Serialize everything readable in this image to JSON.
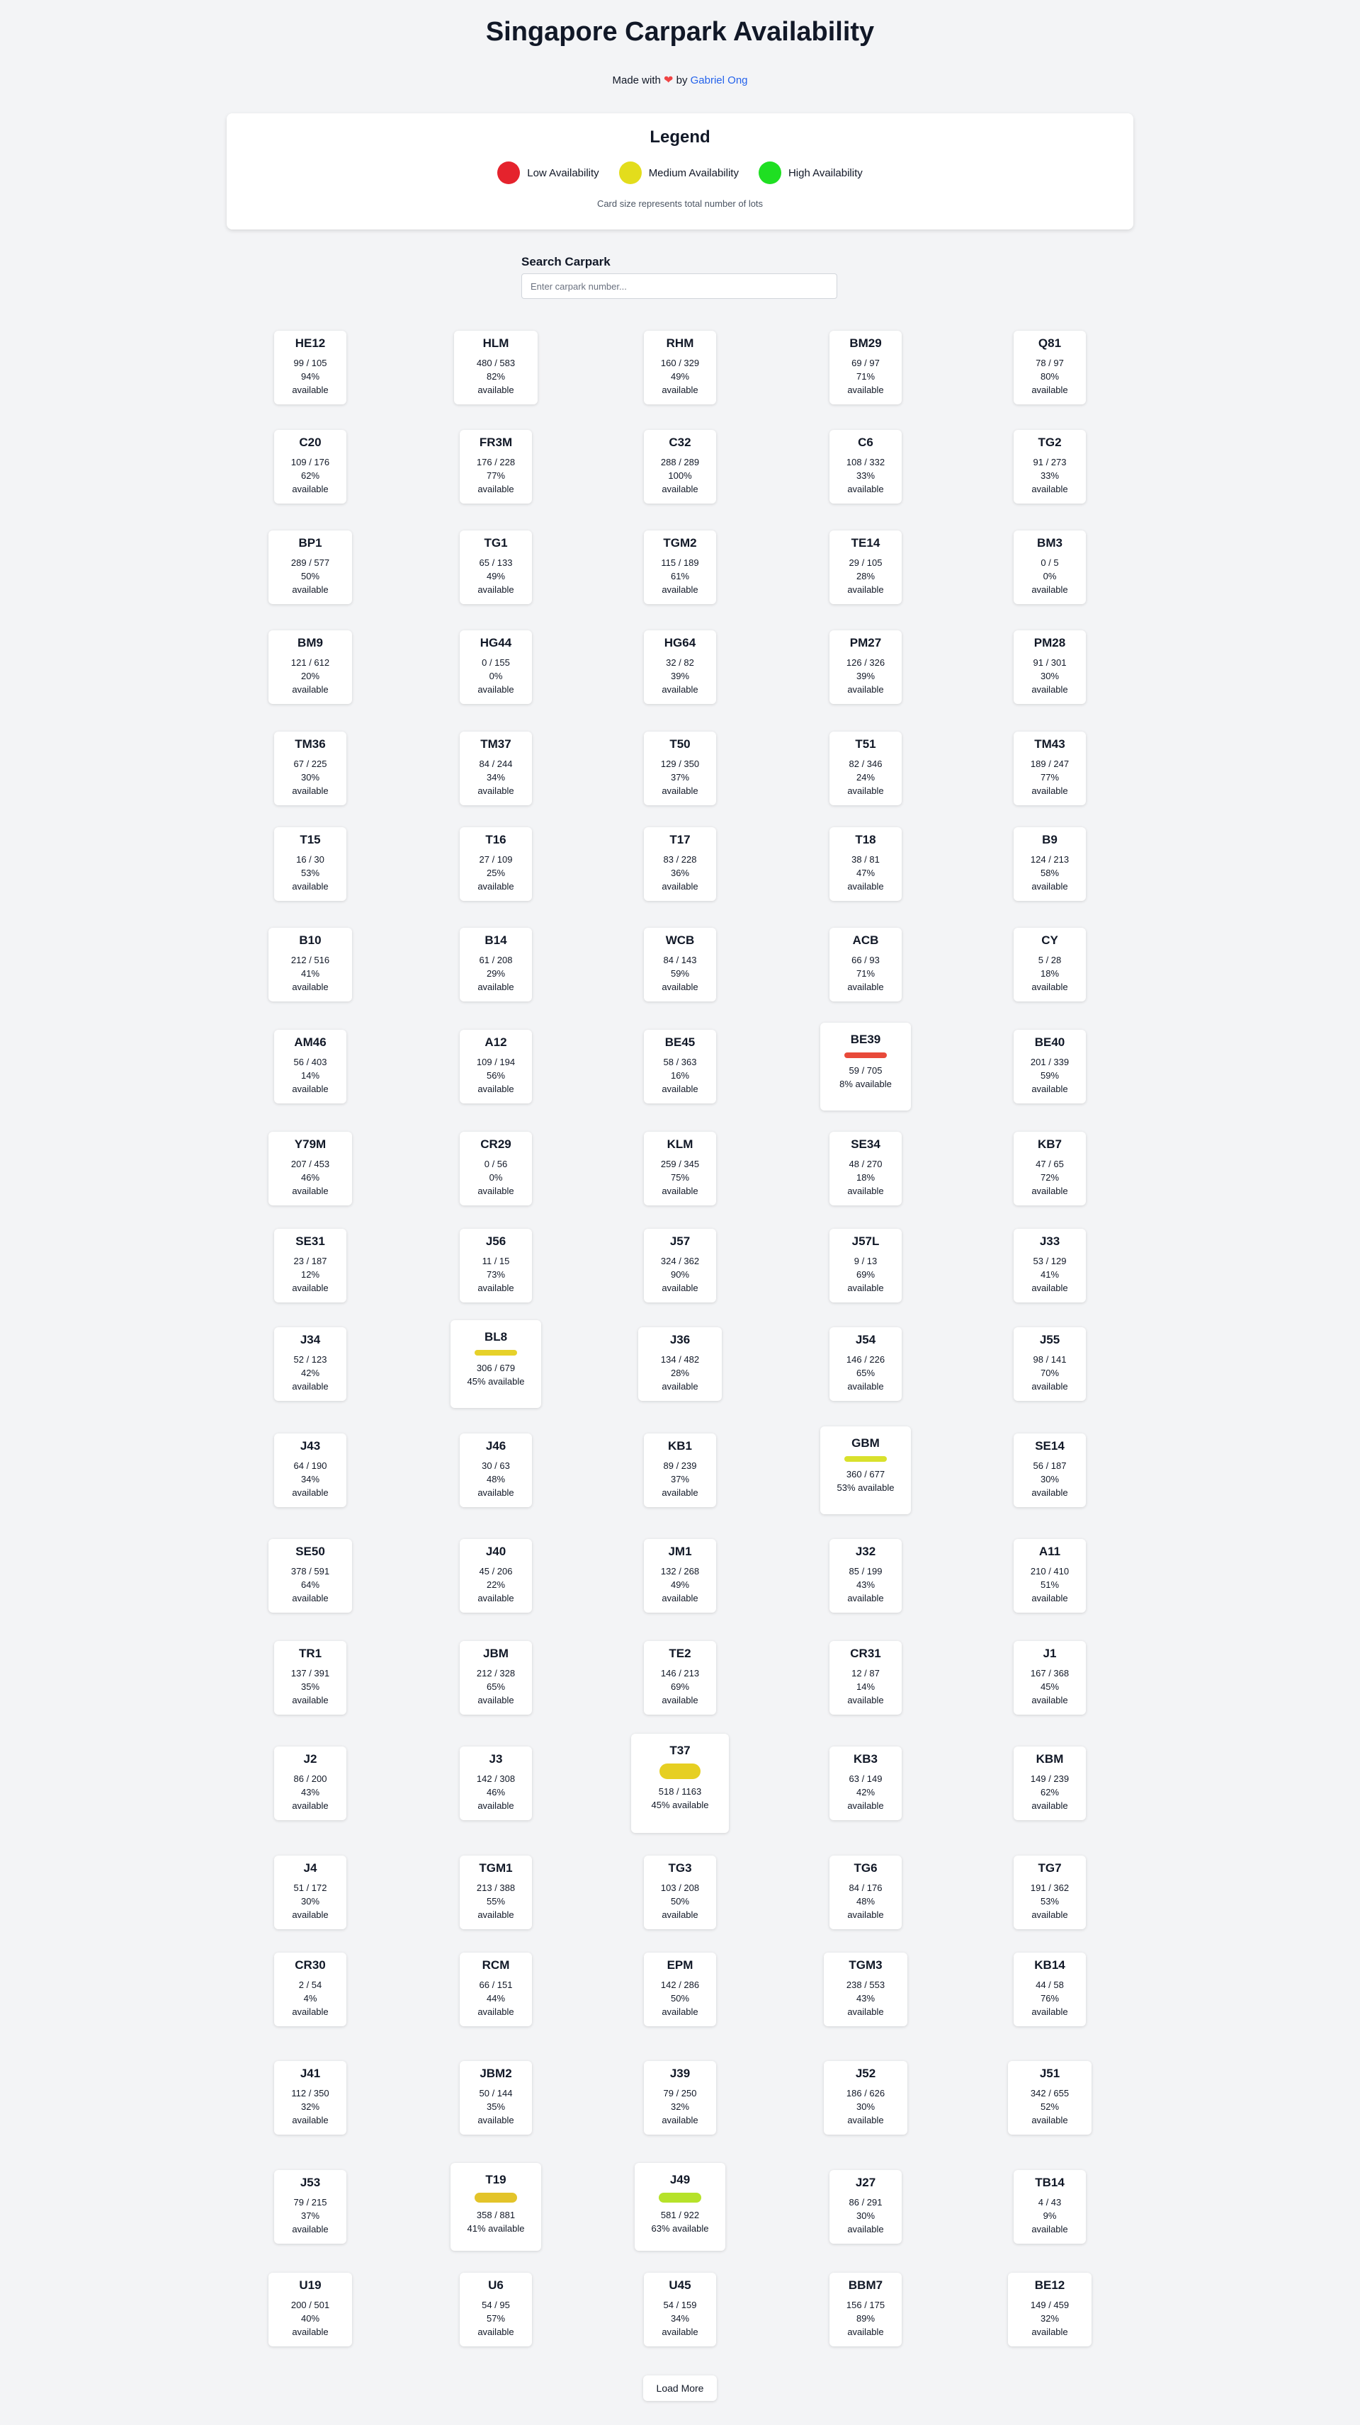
{
  "header": {
    "title": "Singapore Carpark Availability",
    "made_with": "Made with",
    "by": "by",
    "author": "Gabriel Ong"
  },
  "legend": {
    "title": "Legend",
    "items": [
      {
        "label": "Low Availability",
        "color": "#e5232d"
      },
      {
        "label": "Medium Availability",
        "color": "#e3dd1c"
      },
      {
        "label": "High Availability",
        "color": "#1fdf22"
      }
    ],
    "note": "Card size represents total number of lots"
  },
  "search": {
    "label": "Search Carpark",
    "placeholder": "Enter carpark number..."
  },
  "carparks": [
    {
      "name": "HE12",
      "available": 99,
      "total": 105,
      "pct": 94
    },
    {
      "name": "HLM",
      "available": 480,
      "total": 583,
      "pct": 82
    },
    {
      "name": "RHM",
      "available": 160,
      "total": 329,
      "pct": 49
    },
    {
      "name": "BM29",
      "available": 69,
      "total": 97,
      "pct": 71
    },
    {
      "name": "Q81",
      "available": 78,
      "total": 97,
      "pct": 80
    },
    {
      "name": "C20",
      "available": 109,
      "total": 176,
      "pct": 62
    },
    {
      "name": "FR3M",
      "available": 176,
      "total": 228,
      "pct": 77
    },
    {
      "name": "C32",
      "available": 288,
      "total": 289,
      "pct": 100
    },
    {
      "name": "C6",
      "available": 108,
      "total": 332,
      "pct": 33
    },
    {
      "name": "TG2",
      "available": 91,
      "total": 273,
      "pct": 33
    },
    {
      "name": "BP1",
      "available": 289,
      "total": 577,
      "pct": 50
    },
    {
      "name": "TG1",
      "available": 65,
      "total": 133,
      "pct": 49
    },
    {
      "name": "TGM2",
      "available": 115,
      "total": 189,
      "pct": 61
    },
    {
      "name": "TE14",
      "available": 29,
      "total": 105,
      "pct": 28
    },
    {
      "name": "BM3",
      "available": 0,
      "total": 5,
      "pct": 0
    },
    {
      "name": "BM9",
      "available": 121,
      "total": 612,
      "pct": 20
    },
    {
      "name": "HG44",
      "available": 0,
      "total": 155,
      "pct": 0
    },
    {
      "name": "HG64",
      "available": 32,
      "total": 82,
      "pct": 39
    },
    {
      "name": "PM27",
      "available": 126,
      "total": 326,
      "pct": 39
    },
    {
      "name": "PM28",
      "available": 91,
      "total": 301,
      "pct": 30
    },
    {
      "name": "TM36",
      "available": 67,
      "total": 225,
      "pct": 30
    },
    {
      "name": "TM37",
      "available": 84,
      "total": 244,
      "pct": 34
    },
    {
      "name": "T50",
      "available": 129,
      "total": 350,
      "pct": 37
    },
    {
      "name": "T51",
      "available": 82,
      "total": 346,
      "pct": 24
    },
    {
      "name": "TM43",
      "available": 189,
      "total": 247,
      "pct": 77
    },
    {
      "name": "T15",
      "available": 16,
      "total": 30,
      "pct": 53
    },
    {
      "name": "T16",
      "available": 27,
      "total": 109,
      "pct": 25
    },
    {
      "name": "T17",
      "available": 83,
      "total": 228,
      "pct": 36
    },
    {
      "name": "T18",
      "available": 38,
      "total": 81,
      "pct": 47
    },
    {
      "name": "B9",
      "available": 124,
      "total": 213,
      "pct": 58
    },
    {
      "name": "B10",
      "available": 212,
      "total": 516,
      "pct": 41
    },
    {
      "name": "B14",
      "available": 61,
      "total": 208,
      "pct": 29
    },
    {
      "name": "WCB",
      "available": 84,
      "total": 143,
      "pct": 59
    },
    {
      "name": "ACB",
      "available": 66,
      "total": 93,
      "pct": 71
    },
    {
      "name": "CY",
      "available": 5,
      "total": 28,
      "pct": 18
    },
    {
      "name": "AM46",
      "available": 56,
      "total": 403,
      "pct": 14
    },
    {
      "name": "A12",
      "available": 109,
      "total": 194,
      "pct": 56
    },
    {
      "name": "BE45",
      "available": 58,
      "total": 363,
      "pct": 16
    },
    {
      "name": "BE39",
      "available": 59,
      "total": 705,
      "pct": 8,
      "bar_color": "#e84a3a"
    },
    {
      "name": "BE40",
      "available": 201,
      "total": 339,
      "pct": 59
    },
    {
      "name": "Y79M",
      "available": 207,
      "total": 453,
      "pct": 46
    },
    {
      "name": "CR29",
      "available": 0,
      "total": 56,
      "pct": 0
    },
    {
      "name": "KLM",
      "available": 259,
      "total": 345,
      "pct": 75
    },
    {
      "name": "SE34",
      "available": 48,
      "total": 270,
      "pct": 18
    },
    {
      "name": "KB7",
      "available": 47,
      "total": 65,
      "pct": 72
    },
    {
      "name": "SE31",
      "available": 23,
      "total": 187,
      "pct": 12
    },
    {
      "name": "J56",
      "available": 11,
      "total": 15,
      "pct": 73
    },
    {
      "name": "J57",
      "available": 324,
      "total": 362,
      "pct": 90
    },
    {
      "name": "J57L",
      "available": 9,
      "total": 13,
      "pct": 69
    },
    {
      "name": "J33",
      "available": 53,
      "total": 129,
      "pct": 41
    },
    {
      "name": "J34",
      "available": 52,
      "total": 123,
      "pct": 42
    },
    {
      "name": "BL8",
      "available": 306,
      "total": 679,
      "pct": 45,
      "bar_color": "#e6d12a"
    },
    {
      "name": "J36",
      "available": 134,
      "total": 482,
      "pct": 28
    },
    {
      "name": "J54",
      "available": 146,
      "total": 226,
      "pct": 65
    },
    {
      "name": "J55",
      "available": 98,
      "total": 141,
      "pct": 70
    },
    {
      "name": "J43",
      "available": 64,
      "total": 190,
      "pct": 34
    },
    {
      "name": "J46",
      "available": 30,
      "total": 63,
      "pct": 48
    },
    {
      "name": "KB1",
      "available": 89,
      "total": 239,
      "pct": 37
    },
    {
      "name": "GBM",
      "available": 360,
      "total": 677,
      "pct": 53,
      "bar_color": "#d9e12c"
    },
    {
      "name": "SE14",
      "available": 56,
      "total": 187,
      "pct": 30
    },
    {
      "name": "SE50",
      "available": 378,
      "total": 591,
      "pct": 64
    },
    {
      "name": "J40",
      "available": 45,
      "total": 206,
      "pct": 22
    },
    {
      "name": "JM1",
      "available": 132,
      "total": 268,
      "pct": 49
    },
    {
      "name": "J32",
      "available": 85,
      "total": 199,
      "pct": 43
    },
    {
      "name": "A11",
      "available": 210,
      "total": 410,
      "pct": 51
    },
    {
      "name": "TR1",
      "available": 137,
      "total": 391,
      "pct": 35
    },
    {
      "name": "JBM",
      "available": 212,
      "total": 328,
      "pct": 65
    },
    {
      "name": "TE2",
      "available": 146,
      "total": 213,
      "pct": 69
    },
    {
      "name": "CR31",
      "available": 12,
      "total": 87,
      "pct": 14
    },
    {
      "name": "J1",
      "available": 167,
      "total": 368,
      "pct": 45
    },
    {
      "name": "J2",
      "available": 86,
      "total": 200,
      "pct": 43
    },
    {
      "name": "J3",
      "available": 142,
      "total": 308,
      "pct": 46
    },
    {
      "name": "T37",
      "available": 518,
      "total": 1163,
      "pct": 45,
      "bar_color": "#e6cf22"
    },
    {
      "name": "KB3",
      "available": 63,
      "total": 149,
      "pct": 42
    },
    {
      "name": "KBM",
      "available": 149,
      "total": 239,
      "pct": 62
    },
    {
      "name": "J4",
      "available": 51,
      "total": 172,
      "pct": 30
    },
    {
      "name": "TGM1",
      "available": 213,
      "total": 388,
      "pct": 55
    },
    {
      "name": "TG3",
      "available": 103,
      "total": 208,
      "pct": 50
    },
    {
      "name": "TG6",
      "available": 84,
      "total": 176,
      "pct": 48
    },
    {
      "name": "TG7",
      "available": 191,
      "total": 362,
      "pct": 53
    },
    {
      "name": "CR30",
      "available": 2,
      "total": 54,
      "pct": 4
    },
    {
      "name": "RCM",
      "available": 66,
      "total": 151,
      "pct": 44
    },
    {
      "name": "EPM",
      "available": 142,
      "total": 286,
      "pct": 50
    },
    {
      "name": "TGM3",
      "available": 238,
      "total": 553,
      "pct": 43
    },
    {
      "name": "KB14",
      "available": 44,
      "total": 58,
      "pct": 76
    },
    {
      "name": "J41",
      "available": 112,
      "total": 350,
      "pct": 32
    },
    {
      "name": "JBM2",
      "available": 50,
      "total": 144,
      "pct": 35
    },
    {
      "name": "J39",
      "available": 79,
      "total": 250,
      "pct": 32
    },
    {
      "name": "J52",
      "available": 186,
      "total": 626,
      "pct": 30
    },
    {
      "name": "J51",
      "available": 342,
      "total": 655,
      "pct": 52
    },
    {
      "name": "J53",
      "available": 79,
      "total": 215,
      "pct": 37
    },
    {
      "name": "T19",
      "available": 358,
      "total": 881,
      "pct": 41,
      "bar_color": "#e3c42a"
    },
    {
      "name": "J49",
      "available": 581,
      "total": 922,
      "pct": 63,
      "bar_color": "#b6e22a"
    },
    {
      "name": "J27",
      "available": 86,
      "total": 291,
      "pct": 30
    },
    {
      "name": "TB14",
      "available": 4,
      "total": 43,
      "pct": 9
    },
    {
      "name": "U19",
      "available": 200,
      "total": 501,
      "pct": 40
    },
    {
      "name": "U6",
      "available": 54,
      "total": 95,
      "pct": 57
    },
    {
      "name": "U45",
      "available": 54,
      "total": 159,
      "pct": 34
    },
    {
      "name": "BBM7",
      "available": 156,
      "total": 175,
      "pct": 89
    },
    {
      "name": "BE12",
      "available": 149,
      "total": 459,
      "pct": 32
    }
  ],
  "available_label": "available",
  "load_more": "Load More"
}
